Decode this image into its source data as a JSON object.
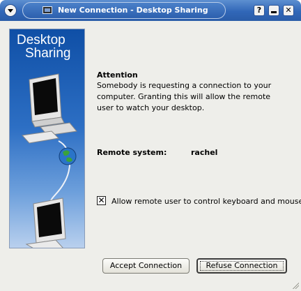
{
  "window": {
    "title": "New Connection - Desktop Sharing",
    "help_label": "?",
    "close_label": "✕"
  },
  "banner": {
    "line1": "Desktop",
    "line2": "Sharing"
  },
  "content": {
    "heading": "Attention",
    "message": "Somebody is requesting a connection to your computer. Granting this will allow the remote user to watch your desktop.",
    "remote_label": "Remote system:",
    "remote_value": "rachel",
    "checkbox_label": "Allow remote user to control keyboard and mouse",
    "checkbox_checked": true,
    "checkbox_mark": "✕"
  },
  "buttons": {
    "accept": "Accept Connection",
    "refuse": "Refuse Connection"
  },
  "colors": {
    "titlebar": "#3167b8",
    "dialog_bg": "#eeeeea",
    "banner_top": "#0f4fa6"
  }
}
